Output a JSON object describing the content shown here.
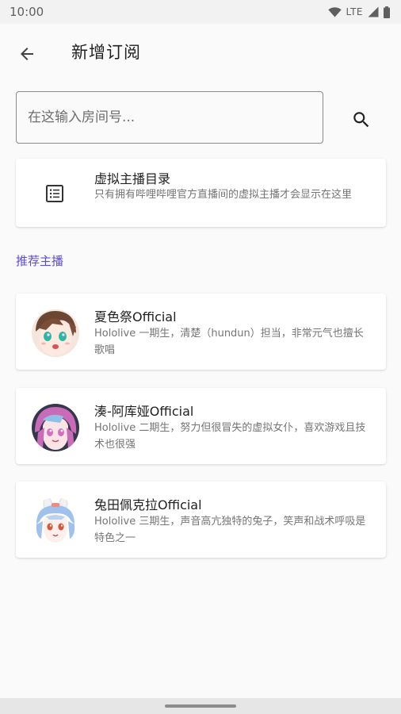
{
  "status_bar": {
    "time": "10:00",
    "network": "LTE",
    "icons": [
      "wifi-icon",
      "cell-signal-icon",
      "battery-icon"
    ]
  },
  "app_bar": {
    "title": "新增订阅",
    "back_icon": "arrow-back-icon"
  },
  "search": {
    "placeholder": "在这输入房间号...",
    "value": "",
    "icon": "search-icon"
  },
  "directory": {
    "icon": "list-icon",
    "title": "虚拟主播目录",
    "description": "只有拥有哔哩哔哩官方直播间的虚拟主播才会显示在这里"
  },
  "recommended": {
    "header": "推荐主播",
    "accent_color": "#5c4dd6",
    "streamers": [
      {
        "name": "夏色祭Official",
        "description": "Hololive 一期生，清楚（hundun）担当，非常元气也擅长歌唱",
        "avatar": "avatar-natsuiro-matsuri"
      },
      {
        "name": "湊-阿库娅Official",
        "description": "Hololive 二期生，努力但很冒失的虚拟女仆，喜欢游戏且技术也很强",
        "avatar": "avatar-minato-aqua"
      },
      {
        "name": "兔田佩克拉Official",
        "description": "Hololive 三期生，声音高亢独特的兔子，笑声和战术呼吸是特色之一",
        "avatar": "avatar-usada-pekora"
      }
    ]
  }
}
